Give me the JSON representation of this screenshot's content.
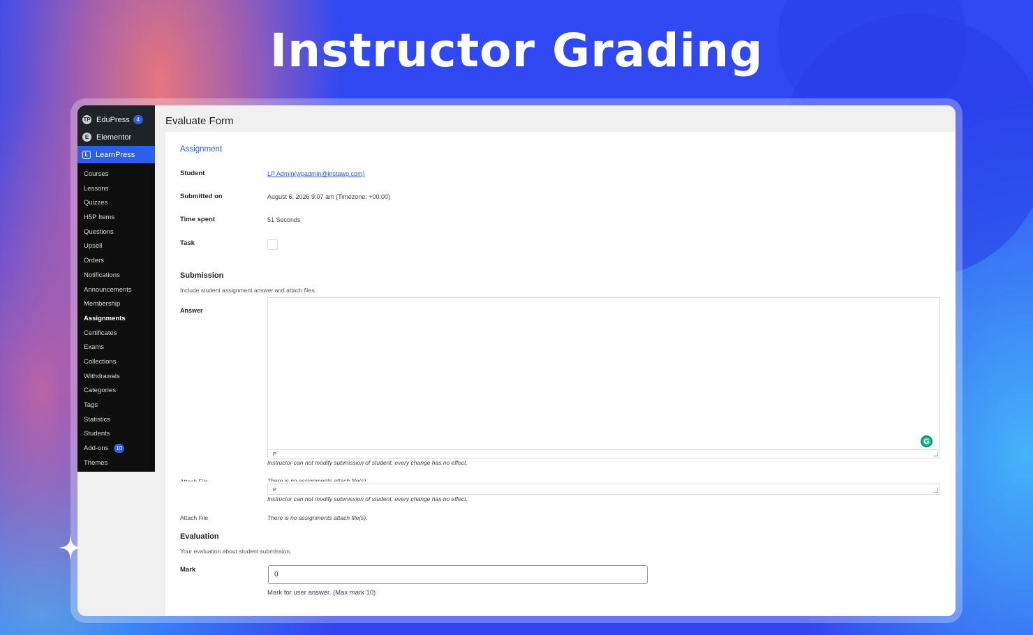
{
  "headline": "Instructor Grading",
  "sidebar": {
    "top_items": [
      {
        "label": "EduPress",
        "badge": "4",
        "icon": "edupress-icon"
      },
      {
        "label": "Elementor",
        "badge": "",
        "icon": "elementor-icon"
      },
      {
        "label": "LearnPress",
        "badge": "",
        "icon": "learnpress-icon"
      }
    ],
    "sub_items": [
      {
        "label": "Courses"
      },
      {
        "label": "Lessons"
      },
      {
        "label": "Quizzes"
      },
      {
        "label": "H5P Items"
      },
      {
        "label": "Questions"
      },
      {
        "label": "Upsell"
      },
      {
        "label": "Orders"
      },
      {
        "label": "Notifications"
      },
      {
        "label": "Announcements"
      },
      {
        "label": "Membership"
      },
      {
        "label": "Assignments"
      },
      {
        "label": "Certificates"
      },
      {
        "label": "Exams"
      },
      {
        "label": "Collections"
      },
      {
        "label": "Withdrawals"
      },
      {
        "label": "Categories"
      },
      {
        "label": "Tags"
      },
      {
        "label": "Statistics"
      },
      {
        "label": "Students"
      },
      {
        "label": "Add-ons",
        "badge": "10"
      },
      {
        "label": "Themes"
      }
    ],
    "current": "Assignments"
  },
  "page": {
    "title": "Evaluate Form",
    "section_link": "Assignment",
    "student_label": "Student",
    "student_value": "LP Admin(wpadmin@instawp.com)",
    "submitted_label": "Submitted on",
    "submitted_value": "August 6, 2026 9:07 am (Timezone: +00:00)",
    "time_label": "Time spent",
    "time_value": "51 Seconds",
    "task_label": "Task"
  },
  "submission": {
    "heading": "Submission",
    "description": "Include student assignment answer and attach files.",
    "answer_label": "Answer",
    "editor_path": "P",
    "note": "Instructor can not modify submission of student, every change has no effect.",
    "attach_label": "Attach File",
    "attach_value": "There is no assignments attach file(s)."
  },
  "evaluation": {
    "heading": "Evaluation",
    "description": "Your evaluation about student submission.",
    "mark_label": "Mark",
    "mark_value": "0",
    "mark_helper": "Mark for user answer. (Max mark 10)"
  },
  "colors": {
    "accent": "#2c5ee8",
    "sidebar_bg": "#1d2327",
    "submenu_bg": "#0e0e0e"
  }
}
